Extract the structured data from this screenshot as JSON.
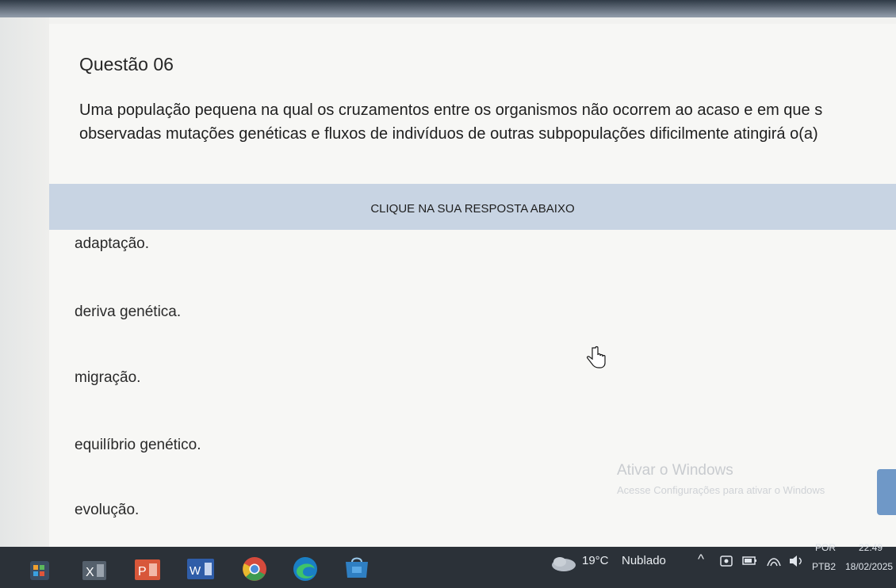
{
  "question": {
    "title": "Questão 06",
    "text": "Uma população pequena na qual os cruzamentos entre os organismos não ocorrem ao acaso e em que s\nobservadas mutações genéticas e fluxos de indivíduos de outras subpopulações dificilmente atingirá o(a)"
  },
  "answer_prompt": "CLIQUE NA SUA RESPOSTA ABAIXO",
  "options": [
    {
      "label": "adaptação."
    },
    {
      "label": "deriva genética."
    },
    {
      "label": "migração."
    },
    {
      "label": "equilíbrio genético."
    },
    {
      "label": "evolução."
    }
  ],
  "watermark": {
    "line1": "Ativar o Windows",
    "line2": "Acesse Configurações para ativar o Windows"
  },
  "taskbar": {
    "weather_temp": "19°C",
    "weather_desc": "Nublado",
    "lang_top": "POR",
    "lang_bottom": "PTB2",
    "time": "22:49",
    "date": "18/02/2025",
    "icons": [
      "start-icon",
      "excel-icon",
      "powerpoint-icon",
      "word-icon",
      "chrome-icon",
      "edge-icon",
      "store-icon"
    ]
  }
}
